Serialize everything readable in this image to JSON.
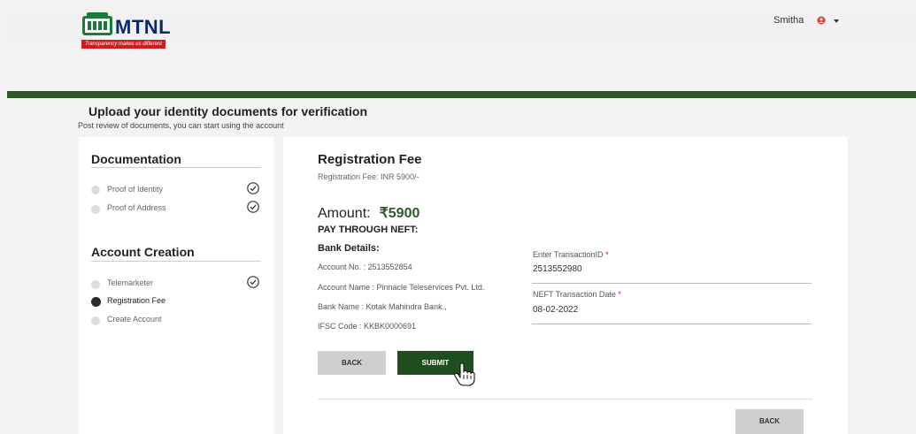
{
  "header": {
    "logo_text": "MTNL",
    "logo_tagline": "Transparency makes us different",
    "username": "Smitha",
    "user_icon": "user-circle-icon",
    "menu_icon": "caret-down-icon"
  },
  "page": {
    "title": "Upload your identity documents for verification",
    "subtitle": "Post review of documents, you can start using the account"
  },
  "sidebar": {
    "documentation": {
      "heading": "Documentation",
      "steps": [
        {
          "label": "Proof of Identity",
          "done": true
        },
        {
          "label": "Proof of Address",
          "done": true
        }
      ]
    },
    "account_creation": {
      "heading": "Account Creation",
      "steps": [
        {
          "label": "Telemarketer",
          "done": true
        },
        {
          "label": "Registration Fee",
          "done": false,
          "active": true
        },
        {
          "label": "Create Account",
          "done": false
        }
      ]
    }
  },
  "main": {
    "title": "Registration Fee",
    "fee_text": "Registration Fee: INR 5900/-",
    "amount_label": "Amount:",
    "amount_value": "₹5900",
    "pay_through": "PAY THROUGH NEFT:",
    "bank_heading": "Bank Details:",
    "bank_lines": [
      "Account No. : 2513552854",
      "Account Name : Pinnacle Teleservices Pvt. Ltd.",
      "Bank Name : Kotak Mahindra Bank.,",
      "IFSC Code : KKBK0000691"
    ],
    "transaction_id": {
      "label": "Enter TransactionID",
      "required_mark": "*",
      "value": "2513552980"
    },
    "neft_date": {
      "label": "NEFT Transaction Date",
      "required_mark": "*",
      "value": "08-02-2022"
    },
    "back_label": "BACK",
    "submit_label": "SUBMIT",
    "bottom_back_label": "BACK"
  },
  "colors": {
    "brand_green": "#2d5a27",
    "submit_green": "#1f4e1f",
    "required_red": "#d02020"
  }
}
